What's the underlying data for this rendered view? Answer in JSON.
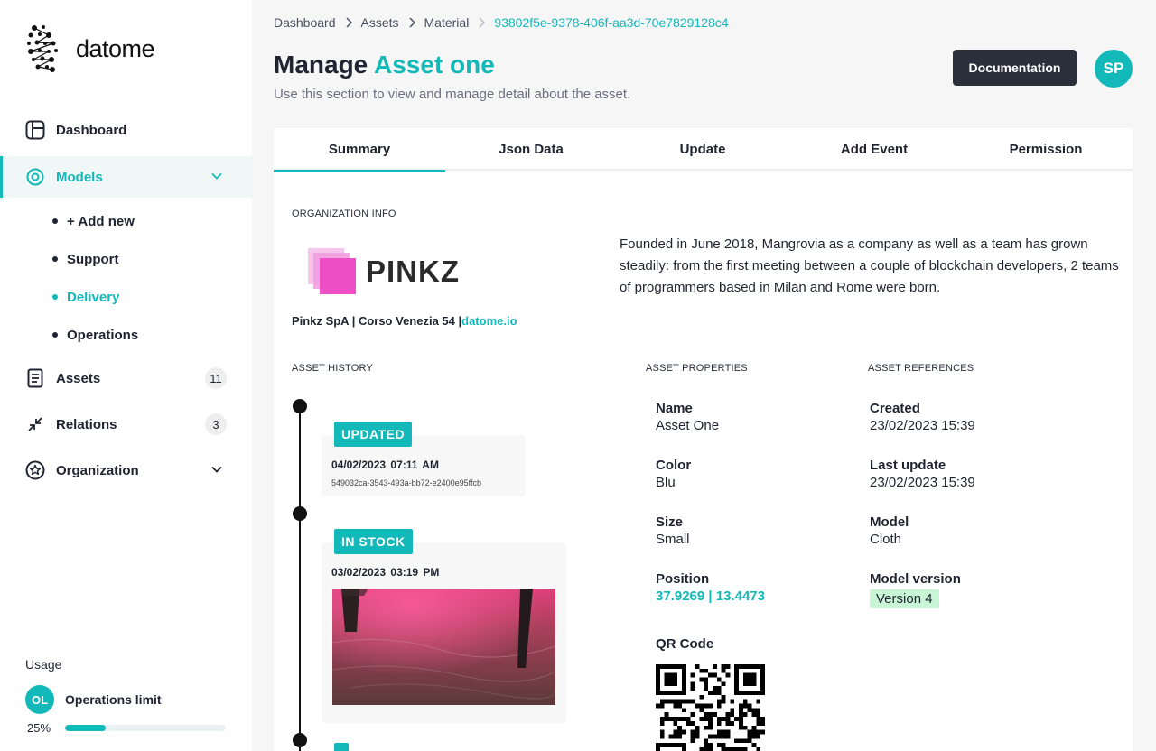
{
  "brand": {
    "name": "datome",
    "accent": "#13b8b8"
  },
  "sidebar": {
    "items": [
      {
        "label": "Dashboard",
        "icon": "dashboard-icon"
      },
      {
        "label": "Models",
        "icon": "models-icon",
        "active": true,
        "expanded": true
      },
      {
        "label": "Assets",
        "icon": "assets-icon",
        "badge": "11"
      },
      {
        "label": "Relations",
        "icon": "relations-icon",
        "badge": "3"
      },
      {
        "label": "Organization",
        "icon": "organization-icon"
      }
    ],
    "models_sub": [
      {
        "label": "+ Add new"
      },
      {
        "label": "Support"
      },
      {
        "label": "Delivery",
        "active": true
      },
      {
        "label": "Operations"
      }
    ],
    "usage": {
      "title": "Usage",
      "avatar": "OL",
      "name": "Operations limit",
      "percent_label": "25%",
      "percent": 25
    }
  },
  "breadcrumb": [
    "Dashboard",
    "Assets",
    "Material",
    "93802f5e-9378-406f-aa3d-70e7829128c4"
  ],
  "header": {
    "title_prefix": "Manage",
    "title_accent": "Asset one",
    "subtitle": "Use this section to view and manage detail about the asset.",
    "doc_button": "Documentation",
    "avatar": "SP"
  },
  "tabs": [
    {
      "label": "Summary",
      "active": true
    },
    {
      "label": "Json Data"
    },
    {
      "label": "Update"
    },
    {
      "label": "Add Event"
    },
    {
      "label": "Permission"
    }
  ],
  "organization": {
    "section_label": "ORGANIZATION INFO",
    "logo_text": "PINKZ",
    "address": "Pinkz SpA | Corso Venezia 54 |",
    "link": "datome.io",
    "description": "Founded in June 2018, Mangrovia as a company as well as a team has grown steadily: from the first meeting between a couple of blockchain developers, 2 teams of programmers based in Milan and Rome were born."
  },
  "history": {
    "section_label": "ASSET HISTORY",
    "events": [
      {
        "badge": "UPDATED",
        "date": "04/02/2023  07:11 AM",
        "id": "549032ca-3543-493a-bb72-e2400e95ffcb"
      },
      {
        "badge": "IN STOCK",
        "date": "03/02/2023  03:19 PM",
        "photo": "pink-lit-wet-floor-photo"
      }
    ]
  },
  "properties": {
    "section_label": "ASSET PROPERTIES",
    "name": {
      "label": "Name",
      "value": "Asset One"
    },
    "color": {
      "label": "Color",
      "value": "Blu"
    },
    "size": {
      "label": "Size",
      "value": "Small"
    },
    "position": {
      "label": "Position",
      "value": "37.9269 | 13.4473"
    },
    "qr": {
      "label": "QR Code"
    }
  },
  "references": {
    "section_label": "ASSET REFERENCES",
    "created": {
      "label": "Created",
      "value": "23/02/2023 15:39"
    },
    "last_update": {
      "label": "Last update",
      "value": "23/02/2023 15:39"
    },
    "model": {
      "label": "Model",
      "value": "Cloth"
    },
    "model_version": {
      "label": "Model version",
      "value": "Version 4"
    }
  }
}
